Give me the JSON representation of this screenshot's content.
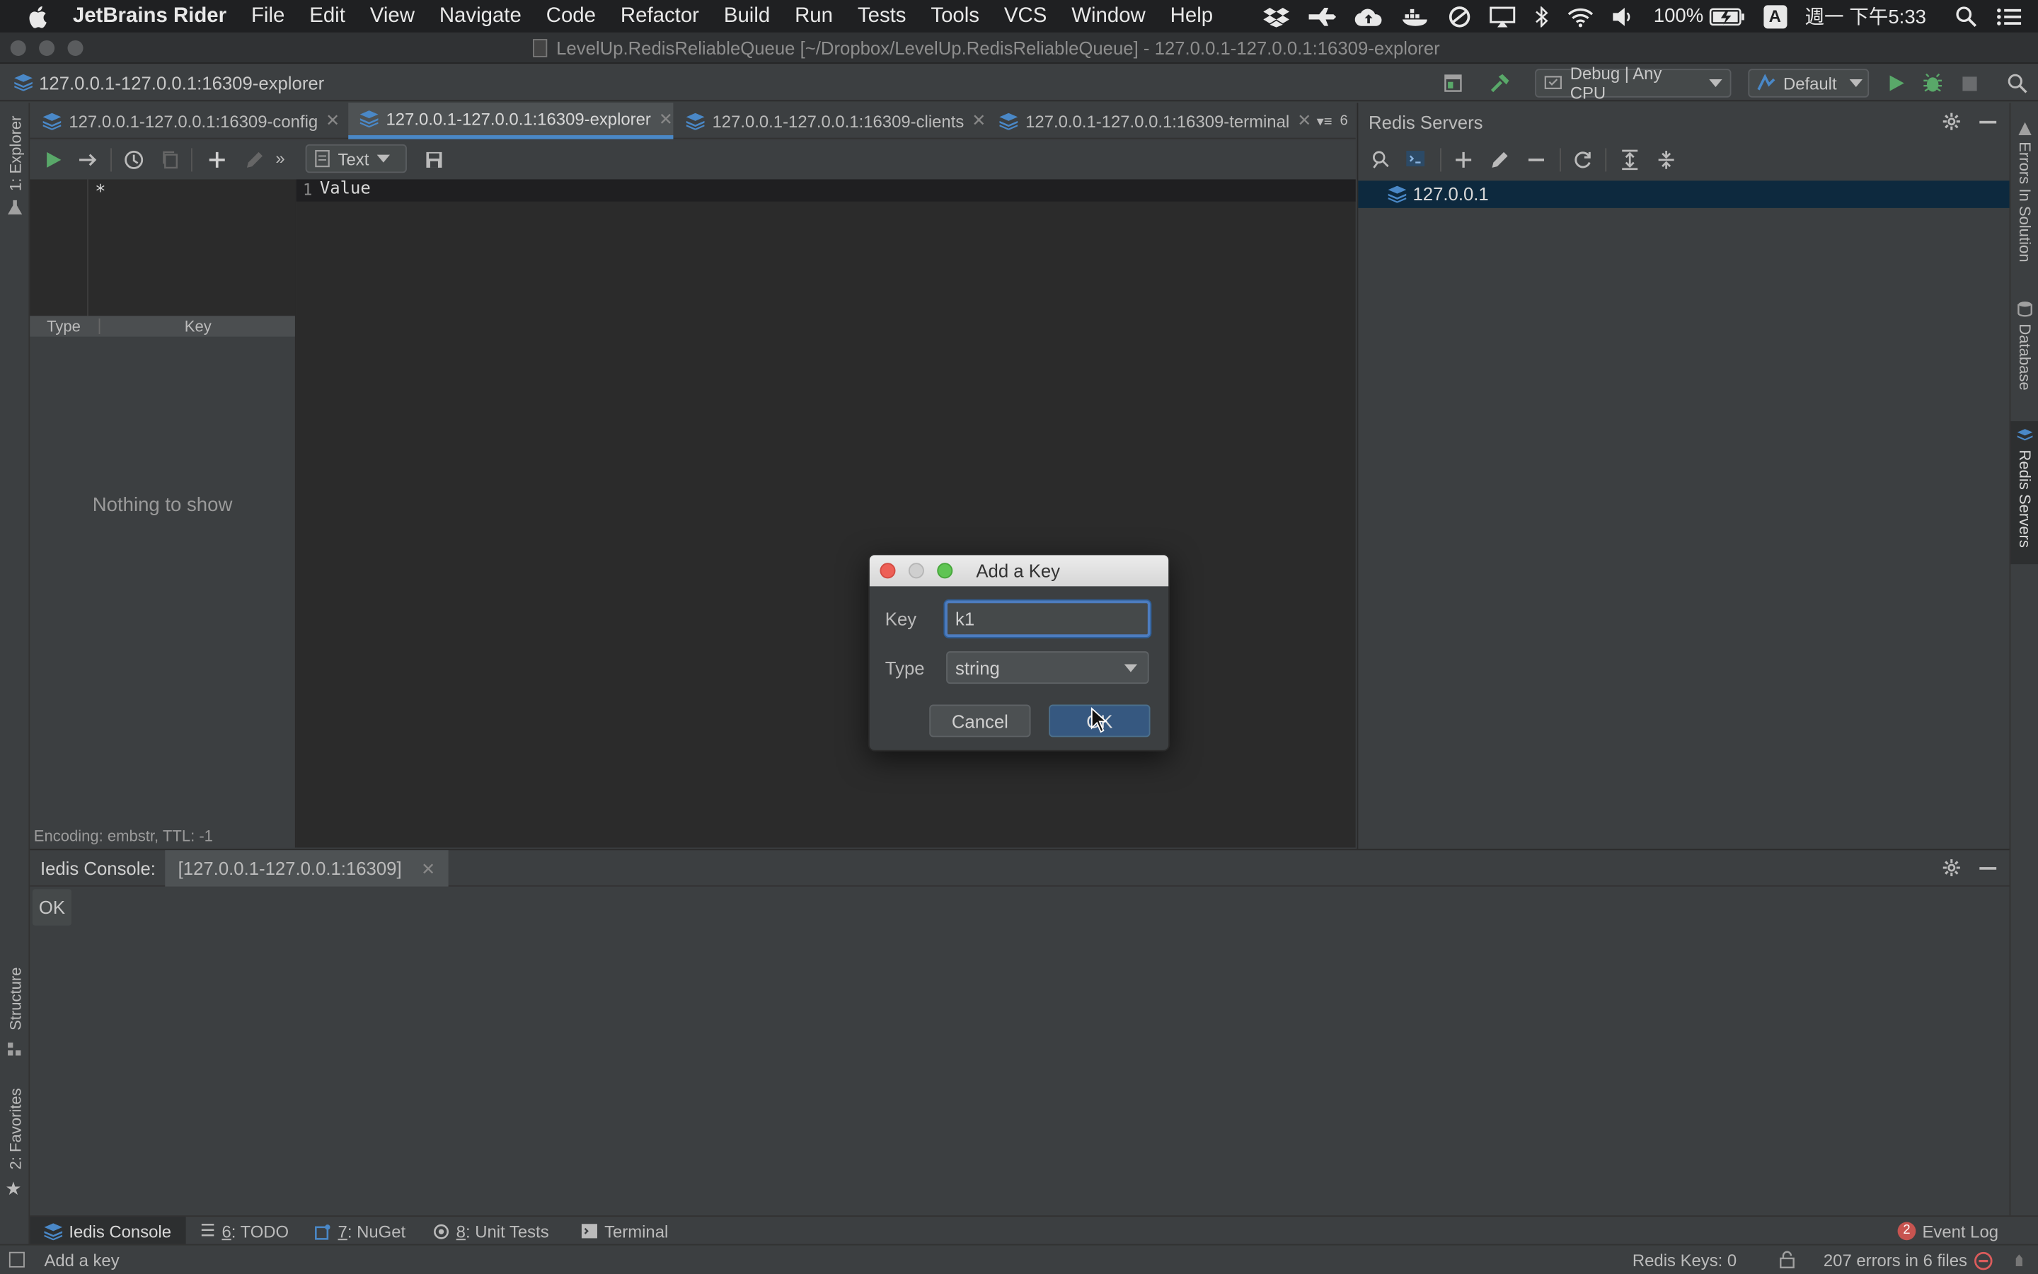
{
  "menubar": {
    "app_name": "JetBrains Rider",
    "items": [
      "File",
      "Edit",
      "View",
      "Navigate",
      "Code",
      "Refactor",
      "Build",
      "Run",
      "Tests",
      "Tools",
      "VCS",
      "Window",
      "Help"
    ],
    "battery": "100%",
    "input_method": "A",
    "clock": "週一 下午5:33"
  },
  "window": {
    "title": "LevelUp.RedisReliableQueue [~/Dropbox/LevelUp.RedisReliableQueue] - 127.0.0.1-127.0.0.1:16309-explorer"
  },
  "navbar": {
    "breadcrumb": "127.0.0.1-127.0.0.1:16309-explorer",
    "config_combo": "Debug | Any CPU",
    "profile_combo": "Default"
  },
  "tabs": {
    "items": [
      {
        "label": "127.0.0.1-127.0.0.1:16309-config"
      },
      {
        "label": "127.0.0.1-127.0.0.1:16309-explorer"
      },
      {
        "label": "127.0.0.1-127.0.0.1:16309-clients"
      },
      {
        "label": "127.0.0.1-127.0.0.1:16309-terminal"
      }
    ],
    "overflow_count": "6"
  },
  "explorer": {
    "format_combo": "Text",
    "filter_pattern": "*",
    "columns": {
      "type": "Type",
      "key": "Key"
    },
    "empty_text": "Nothing to show",
    "encoding_info": "Encoding: embstr, TTL: -1",
    "editor_line_number": "1",
    "editor_text": "Value"
  },
  "left_strip": {
    "explorer": "1: Explorer",
    "structure": "Structure",
    "favorites": "2: Favorites"
  },
  "right_strip": {
    "errors": "Errors In Solution",
    "database": "Database",
    "redis_servers": "Redis Servers"
  },
  "redis_panel": {
    "title": "Redis Servers",
    "servers": [
      "127.0.0.1"
    ]
  },
  "console": {
    "label": "Iedis Console:",
    "tab": "[127.0.0.1-127.0.0.1:16309]",
    "output": "OK"
  },
  "toolwindows": {
    "items": [
      {
        "label": "Iedis Console",
        "num": ""
      },
      {
        "label": ": TODO",
        "num": "6"
      },
      {
        "label": ": NuGet",
        "num": "7"
      },
      {
        "label": ": Unit Tests",
        "num": "8"
      },
      {
        "label": "Terminal",
        "num": ""
      }
    ],
    "event_log_badge": "2",
    "event_log": "Event Log"
  },
  "status": {
    "message": "Add a key",
    "redis_keys": "Redis Keys: 0",
    "errors": "207 errors in 6 files"
  },
  "dialog": {
    "title": "Add a Key",
    "key_label": "Key",
    "key_value": "k1",
    "type_label": "Type",
    "type_value": "string",
    "cancel": "Cancel",
    "ok": "OK"
  },
  "colors": {
    "accent": "#4a88c7",
    "ok_button": "#365880",
    "selection": "#0d293e",
    "run_green": "#59a869",
    "error_red": "#db5c5c"
  }
}
